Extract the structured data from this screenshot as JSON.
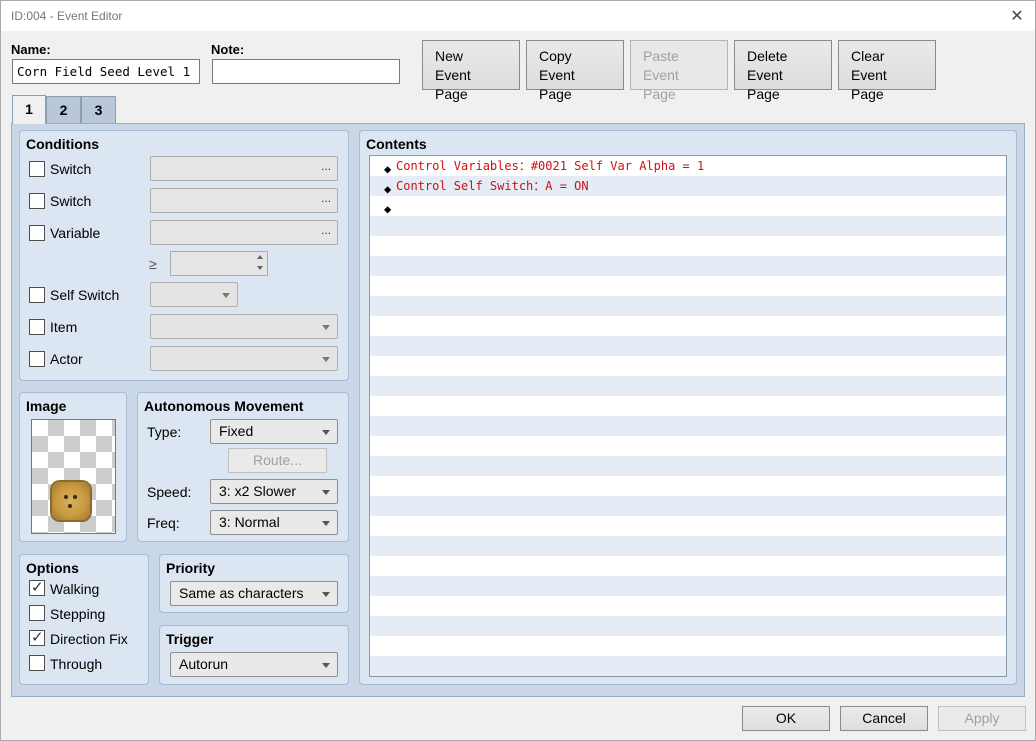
{
  "window": {
    "title": "ID:004 - Event Editor",
    "close_glyph": "✕"
  },
  "name_label": "Name:",
  "name_value": "Corn Field Seed Level 1",
  "note_label": "Note:",
  "note_value": "",
  "page_buttons": {
    "new": "New\nEvent Page",
    "copy": "Copy\nEvent Page",
    "paste": "Paste\nEvent Page",
    "delete": "Delete\nEvent Page",
    "clear": "Clear\nEvent Page"
  },
  "tabs": [
    "1",
    "2",
    "3"
  ],
  "active_tab": "1",
  "conditions": {
    "title": "Conditions",
    "switch1": {
      "label": "Switch",
      "checked": false
    },
    "switch2": {
      "label": "Switch",
      "checked": false
    },
    "variable": {
      "label": "Variable",
      "checked": false
    },
    "ge_symbol": "≥",
    "self_switch": {
      "label": "Self Switch",
      "checked": false
    },
    "item": {
      "label": "Item",
      "checked": false
    },
    "actor": {
      "label": "Actor",
      "checked": false
    },
    "dots": "..."
  },
  "image": {
    "title": "Image",
    "sprite": "corn-seed-sprite"
  },
  "movement": {
    "title": "Autonomous Movement",
    "type_label": "Type:",
    "type_value": "Fixed",
    "route_button": "Route...",
    "speed_label": "Speed:",
    "speed_value": "3: x2 Slower",
    "freq_label": "Freq:",
    "freq_value": "3: Normal"
  },
  "options": {
    "title": "Options",
    "walking": {
      "label": "Walking",
      "checked": true
    },
    "stepping": {
      "label": "Stepping",
      "checked": false
    },
    "direction_fix": {
      "label": "Direction Fix",
      "checked": true
    },
    "through": {
      "label": "Through",
      "checked": false
    }
  },
  "priority": {
    "title": "Priority",
    "value": "Same as characters"
  },
  "trigger": {
    "title": "Trigger",
    "value": "Autorun"
  },
  "contents": {
    "title": "Contents",
    "diamond": "◆",
    "commands": [
      "Control Variables：#0021 Self Var Alpha = 1",
      "Control Self Switch：A = ON",
      ""
    ]
  },
  "dialog_buttons": {
    "ok": "OK",
    "cancel": "Cancel",
    "apply": "Apply"
  },
  "colors": {
    "command_text": "#d01010",
    "panel_bg": "#dce6f2",
    "tab_bg": "#c9d7e8"
  }
}
